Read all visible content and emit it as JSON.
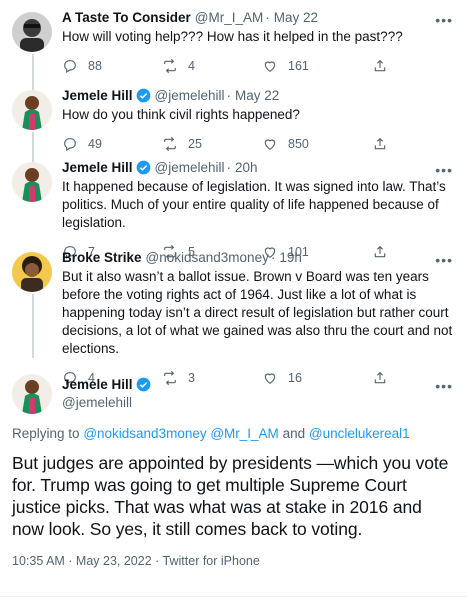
{
  "tweets": [
    {
      "name": "A Taste To Consider",
      "handle": "@Mr_I_AM",
      "sep": "·",
      "date": "May 22",
      "verified": false,
      "text": "How will voting help??? How has it helped in the past???",
      "replies": "88",
      "retweets": "4",
      "likes": "161"
    },
    {
      "name": "Jemele Hill",
      "handle": "@jemelehill",
      "sep": "·",
      "date": "May 22",
      "verified": true,
      "text": "How do you think civil rights happened?",
      "replies": "49",
      "retweets": "25",
      "likes": "850"
    },
    {
      "name": "Jemele Hill",
      "handle": "@jemelehill",
      "sep": "·",
      "date": "20h",
      "verified": true,
      "text": "It happened because of legislation. It was signed into law. That’s politics. Much of your entire quality of life happened because of legislation.",
      "replies": "7",
      "retweets": "5",
      "likes": "101"
    },
    {
      "name": "Broke Strike",
      "handle": "@nokidsand3money",
      "sep": "·",
      "date": "19h",
      "verified": false,
      "text": "But it also wasn’t a ballot issue. Brown v Board was ten years before the voting rights act of 1964. Just like a lot of what is happening today isn’t a direct result of legislation but rather court decisions, a lot of what we gained was also thru the court and not elections.",
      "replies": "4",
      "retweets": "3",
      "likes": "16"
    }
  ],
  "main_tweet": {
    "name": "Jemele Hill",
    "handle": "@jemelehill",
    "replying_prefix": "Replying to",
    "replying_to": "@nokidsand3money @Mr_I_AM",
    "replying_and": "and",
    "replying_last": "@unclelukereal1",
    "text": "But judges are appointed by presidents —which you vote for. Trump was going to get multiple Supreme Court justice picks. That was what was at stake in 2016 and now look. So yes, it still comes back to voting.",
    "meta": "10:35 AM · May 23, 2022 · Twitter for iPhone"
  },
  "more_label": "•••",
  "colors": {
    "accent": "#1d9bf0",
    "text": "#0f1419",
    "secondary": "#536471"
  }
}
